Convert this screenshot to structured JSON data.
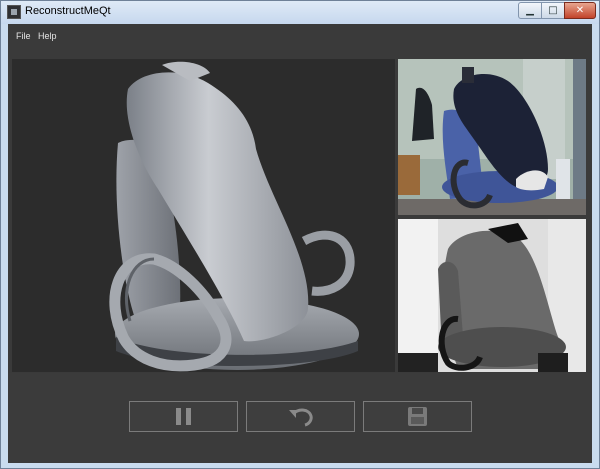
{
  "window": {
    "title": "ReconstructMeQt",
    "controls": {
      "minimize": "▁",
      "maximize": "□",
      "close": "✕"
    }
  },
  "menu": {
    "items": [
      "File",
      "Help"
    ]
  },
  "views": {
    "reconstruction": {
      "icon": "mesh-preview"
    },
    "camera": {
      "icon": "rgb-camera-feed"
    },
    "depth": {
      "icon": "depth-map"
    }
  },
  "toolbar": {
    "buttons": [
      {
        "icon": "pause-icon"
      },
      {
        "icon": "undo-icon"
      },
      {
        "icon": "save-icon"
      }
    ]
  },
  "colors": {
    "background": "#3a3a3a",
    "button_border": "#7b7b7b",
    "icon": "#8a8a8a",
    "titlebar": "#c9dbee"
  }
}
